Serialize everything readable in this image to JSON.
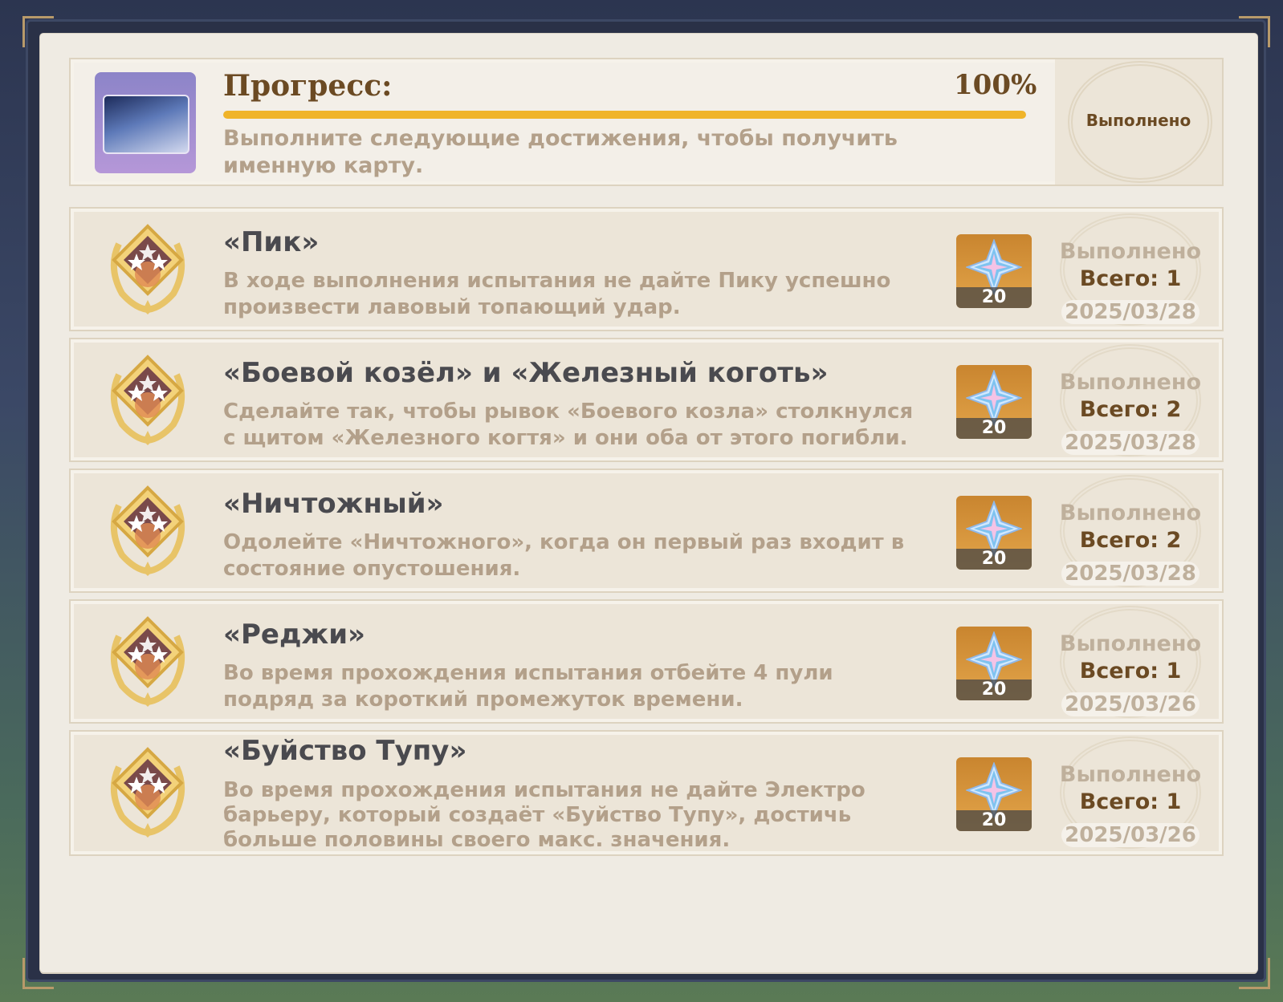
{
  "progress": {
    "title": "Прогресс:",
    "percent_label": "100%",
    "percent_value": 100,
    "description": "Выполните следующие достижения, чтобы получить именную карту.",
    "status": "Выполнено",
    "icon": "namecard-icon"
  },
  "achievements": [
    {
      "title": "«Пик»",
      "description": "В ходе выполнения испытания не дайте Пику успешно произвести лавовый топающий удар.",
      "reward_count": "20",
      "status": "Выполнено",
      "total": "Всего: 1",
      "date": "2025/03/28"
    },
    {
      "title": "«Боевой козёл» и «Железный коготь»",
      "description": "Сделайте так, чтобы рывок «Боевого козла» столкнулся с щитом «Железного когтя» и они оба от этого погибли.",
      "reward_count": "20",
      "status": "Выполнено",
      "total": "Всего: 2",
      "date": "2025/03/28"
    },
    {
      "title": "«Ничтожный»",
      "description": "Одолейте «Ничтожного», когда он первый раз входит в состояние опустошения.",
      "reward_count": "20",
      "status": "Выполнено",
      "total": "Всего: 2",
      "date": "2025/03/28"
    },
    {
      "title": "«Реджи»",
      "description": "Во время прохождения испытания отбейте 4 пули подряд за короткий промежуток времени.",
      "reward_count": "20",
      "status": "Выполнено",
      "total": "Всего: 1",
      "date": "2025/03/26"
    },
    {
      "title": "«Буйство Тупу»",
      "description": "Во время прохождения испытания не дайте Электро барьеру, который создаёт «Буйство Тупу», достичь больше половины своего макс. значения.",
      "reward_count": "20",
      "status": "Выполнено",
      "total": "Всего: 1",
      "date": "2025/03/26"
    }
  ],
  "colors": {
    "accent": "#f0b429",
    "title_brown": "#6b4a23",
    "desc": "#b3a08a"
  }
}
